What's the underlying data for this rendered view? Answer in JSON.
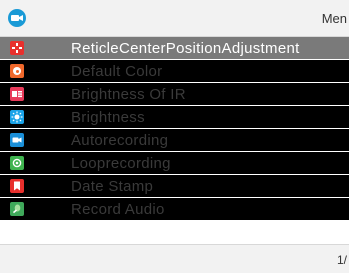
{
  "header": {
    "title": "Men",
    "icon": "camera-icon"
  },
  "menu": {
    "items": [
      {
        "label": "ReticleCenterPositionAdjustment",
        "icon": "crosshair-icon",
        "color": "#e8302d",
        "selected": true
      },
      {
        "label": "Default Color",
        "icon": "palette-icon",
        "color": "#f0682b",
        "selected": false
      },
      {
        "label": "Brightness Of IR",
        "icon": "ir-brightness-icon",
        "color": "#e83a5a",
        "selected": false
      },
      {
        "label": "Brightness",
        "icon": "sun-icon",
        "color": "#1aa3e8",
        "selected": false
      },
      {
        "label": "Autorecording",
        "icon": "video-icon",
        "color": "#1a8fd8",
        "selected": false
      },
      {
        "label": "Looprecording",
        "icon": "loop-icon",
        "color": "#3fb34f",
        "selected": false
      },
      {
        "label": "Date Stamp",
        "icon": "bookmark-icon",
        "color": "#e8302d",
        "selected": false
      },
      {
        "label": "Record Audio",
        "icon": "microphone-icon",
        "color": "#3fa85a",
        "selected": false
      }
    ]
  },
  "footer": {
    "page": "1/"
  }
}
